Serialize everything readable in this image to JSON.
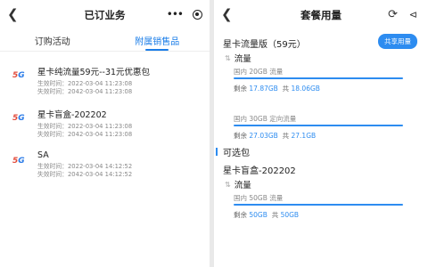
{
  "left": {
    "title": "已订业务",
    "tabs": [
      {
        "label": "订购活动",
        "active": false
      },
      {
        "label": "附属销售品",
        "active": true
      }
    ],
    "products": [
      {
        "name": "星卡纯流量59元--31元优惠包",
        "effective": "生效时间：2022-03-04 11:23:08",
        "expire": "失效时间：2042-03-04 11:23:08"
      },
      {
        "name": "星卡盲盒-202202",
        "effective": "生效时间：2022-03-04 11:23:08",
        "expire": "失效时间：2042-03-04 11:23:08"
      },
      {
        "name": "SA",
        "effective": "生效时间：2022-03-04 14:12:52",
        "expire": "失效时间：2042-03-04 14:12:52"
      }
    ],
    "logo_text": "5G"
  },
  "right": {
    "title": "套餐用量",
    "package_name": "星卡流量版（59元）",
    "share_button": "共享用量",
    "flow_label": "流量",
    "quotas": [
      {
        "name": "国内 20GB 流量",
        "remain_label": "剩余",
        "remain": "17.87GB",
        "total_label": "共",
        "total": "18.06GB"
      },
      {
        "name": "国内 30GB 定向流量",
        "remain_label": "剩余",
        "remain": "27.03GB",
        "total_label": "共",
        "total": "27.1GB"
      }
    ],
    "optional_section": "可选包",
    "optional_package": "星卡盲盒-202202",
    "optional_flow_label": "流量",
    "optional_quota": {
      "name": "国内 50GB 流量",
      "remain_label": "剩余",
      "remain": "50GB",
      "total_label": "共",
      "total": "50GB"
    }
  },
  "colors": {
    "accent": "#2d8cf0",
    "tab_active": "#1a7de8"
  }
}
